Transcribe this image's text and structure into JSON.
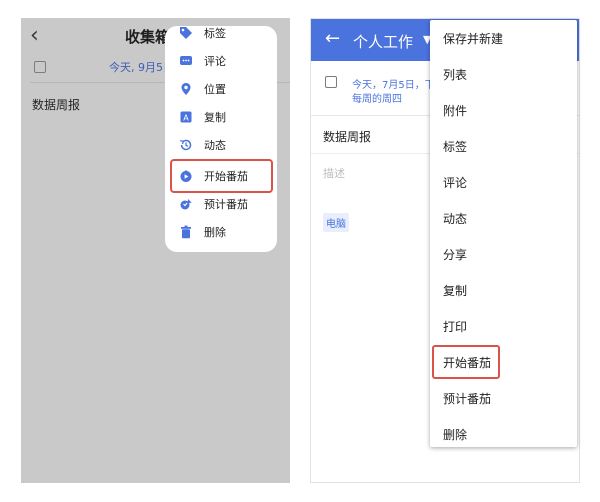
{
  "left_screen": {
    "back_glyph": "‹",
    "title": "收集箱",
    "date_text": "今天, 9月5日",
    "task_title": "数据周报",
    "menu": {
      "items": [
        {
          "icon": "tag-icon",
          "label": "标签"
        },
        {
          "icon": "comment-icon",
          "label": "评论"
        },
        {
          "icon": "location-pin-icon",
          "label": "位置"
        },
        {
          "icon": "copy-icon",
          "label": "复制"
        },
        {
          "icon": "history-icon",
          "label": "动态"
        },
        {
          "icon": "pomodoro-play-icon",
          "label": "开始番茄"
        },
        {
          "icon": "estimate-pomodoro-icon",
          "label": "预计番茄"
        },
        {
          "icon": "trash-icon",
          "label": "删除"
        }
      ],
      "highlighted": "开始番茄"
    }
  },
  "right_screen": {
    "app_bar": {
      "back_glyph": "←",
      "title": "个人工作",
      "color": "#4b73de"
    },
    "date_text": "今天，7月5日，下",
    "repeat_text": "每周的周四",
    "task_title": "数据周报",
    "description_placeholder": "描述",
    "tag": "电脑",
    "menu": {
      "items": [
        "保存并新建",
        "列表",
        "附件",
        "标签",
        "评论",
        "动态",
        "分享",
        "复制",
        "打印",
        "开始番茄",
        "预计番茄",
        "删除"
      ],
      "highlighted": "开始番茄"
    }
  },
  "colors": {
    "highlight": "#d9534a",
    "accent_blue": "#4b73de",
    "dim_overlay": "#c9c9c9"
  }
}
